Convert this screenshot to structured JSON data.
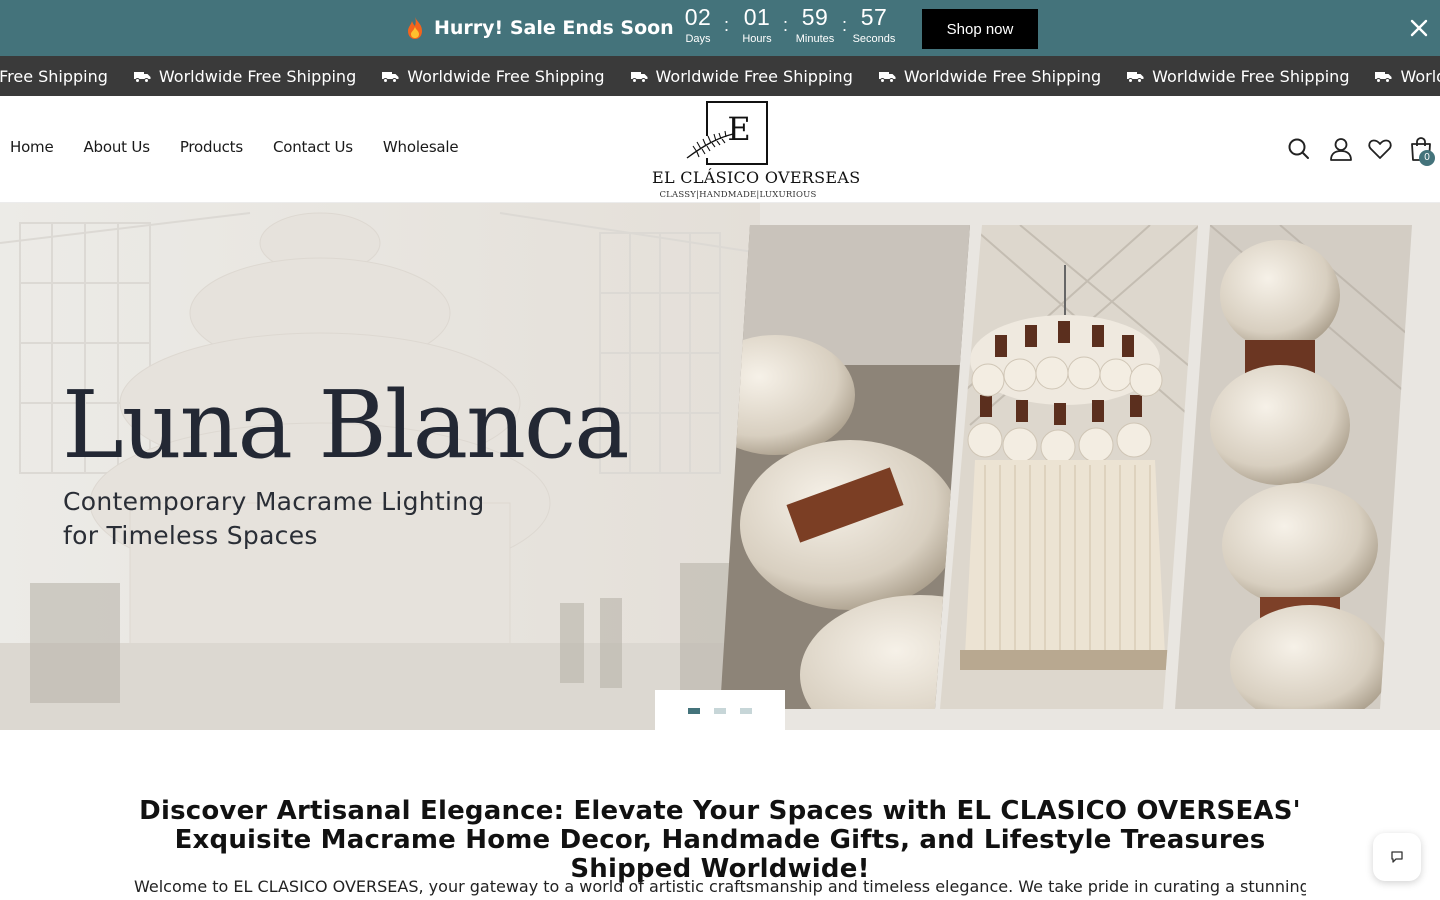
{
  "announcement": {
    "text": "Hurry! Sale Ends Soon",
    "countdown": [
      {
        "value": "02",
        "unit": "Days"
      },
      {
        "value": "01",
        "unit": "Hours"
      },
      {
        "value": "59",
        "unit": "Minutes"
      },
      {
        "value": "57",
        "unit": "Seconds"
      }
    ],
    "separator": ":",
    "button_label": "Shop now",
    "background_color": "#44737b"
  },
  "marquee": {
    "items": [
      "de Free Shipping",
      "Worldwide Free Shipping",
      "Worldwide Free Shipping",
      "Worldwide Free Shipping",
      "Worldwide Free Shipping",
      "Worldwide Free Shipping",
      "Worldwide Free Shippin"
    ],
    "icon": "truck-icon",
    "background_color": "#3a3a3a"
  },
  "nav": {
    "items": [
      "Home",
      "About Us",
      "Products",
      "Contact Us",
      "Wholesale"
    ]
  },
  "logo": {
    "letter": "E",
    "name": "EL CLÁSICO OVERSEAS",
    "tagline": "CLASSY|HANDMADE|LUXURIOUS"
  },
  "header_icons": {
    "search": "search-icon",
    "account": "user-icon",
    "wishlist": "heart-icon",
    "cart": "shopping-bag-icon",
    "cart_count": "0"
  },
  "hero": {
    "title": "Luna Blanca",
    "subtitle_line1": "Contemporary Macrame Lighting",
    "subtitle_line2": "for Timeless Spaces",
    "slides_total": 3,
    "active_slide": 1
  },
  "intro": {
    "title": "Discover Artisanal Elegance: Elevate Your Spaces with EL CLASICO OVERSEAS' Exquisite Macrame Home Decor, Handmade Gifts, and Lifestyle Treasures Shipped Worldwide!",
    "text": "Welcome to EL CLASICO OVERSEAS, your gateway to a world of artistic craftsmanship and timeless elegance. We take pride in curating a stunning collection of"
  },
  "chat": {
    "icon": "chat-icon"
  }
}
